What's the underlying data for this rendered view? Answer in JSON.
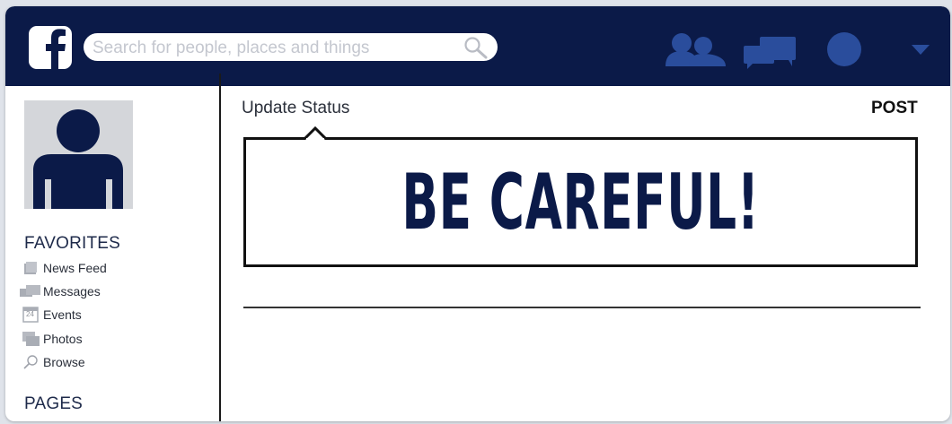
{
  "topbar": {
    "logo_icon": "facebook-logo-icon",
    "search": {
      "placeholder": "Search for people, places and things",
      "value": "",
      "icon": "search-icon"
    },
    "icons": [
      "friends-icon",
      "messages-icon",
      "notifications-icon",
      "dropdown-arrow-icon"
    ],
    "background_color": "#0b1a48"
  },
  "sidebar": {
    "avatar_icon": "profile-avatar-icon",
    "favorites_title": "FAVORITES",
    "items": [
      {
        "label": "News Feed",
        "icon": "news-feed-icon"
      },
      {
        "label": "Messages",
        "icon": "messages-icon"
      },
      {
        "label": "Events",
        "icon": "calendar-icon",
        "icon_text": "24"
      },
      {
        "label": "Photos",
        "icon": "photos-icon"
      },
      {
        "label": "Browse",
        "icon": "search-icon"
      }
    ],
    "pages_title": "PAGES"
  },
  "main": {
    "update_status_label": "Update Status",
    "post_label": "POST",
    "status_text": "BE CAREFUL!",
    "accent_color": "#0b1a48"
  }
}
